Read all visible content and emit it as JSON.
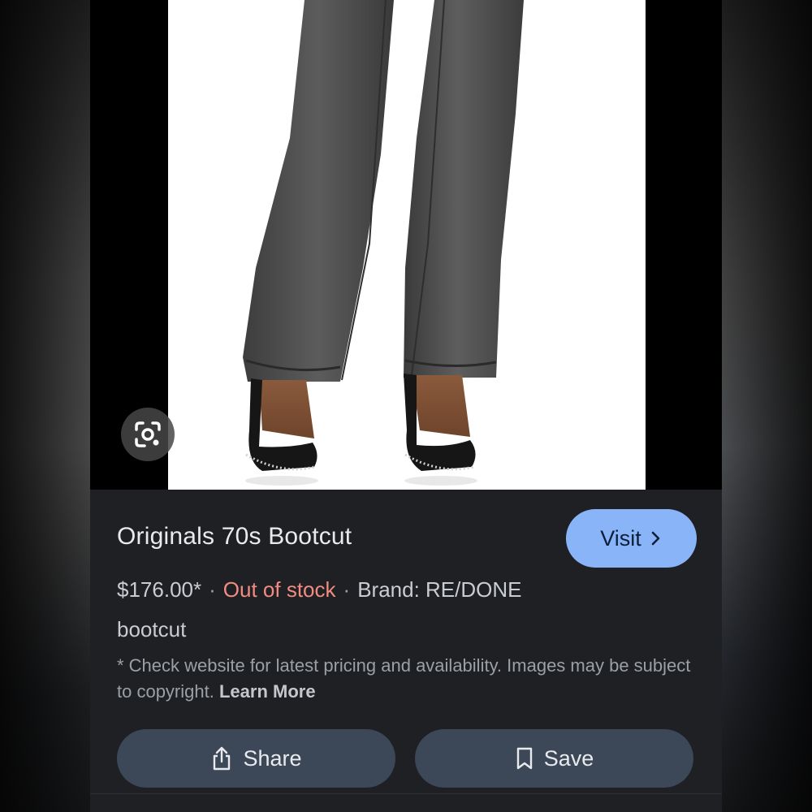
{
  "product": {
    "title": "Originals 70s Bootcut",
    "price": "$176.00*",
    "stock_status": "Out of stock",
    "brand": "Brand: RE/DONE",
    "tag": "bootcut",
    "image_alt_icon": "jeans-product-image"
  },
  "visit": {
    "label": "Visit",
    "icon": "chevron-right-icon"
  },
  "lens": {
    "icon": "google-lens-icon"
  },
  "disclaimer": {
    "text": "* Check website for latest pricing and availability. Images may be subject to copyright.",
    "link_label": "Learn More"
  },
  "actions": {
    "share_label": "Share",
    "save_label": "Save"
  },
  "colors": {
    "background": "#1f2023",
    "accent": "#8ab4f8",
    "out_of_stock": "#f28b82",
    "button_bg": "#3c4858"
  }
}
